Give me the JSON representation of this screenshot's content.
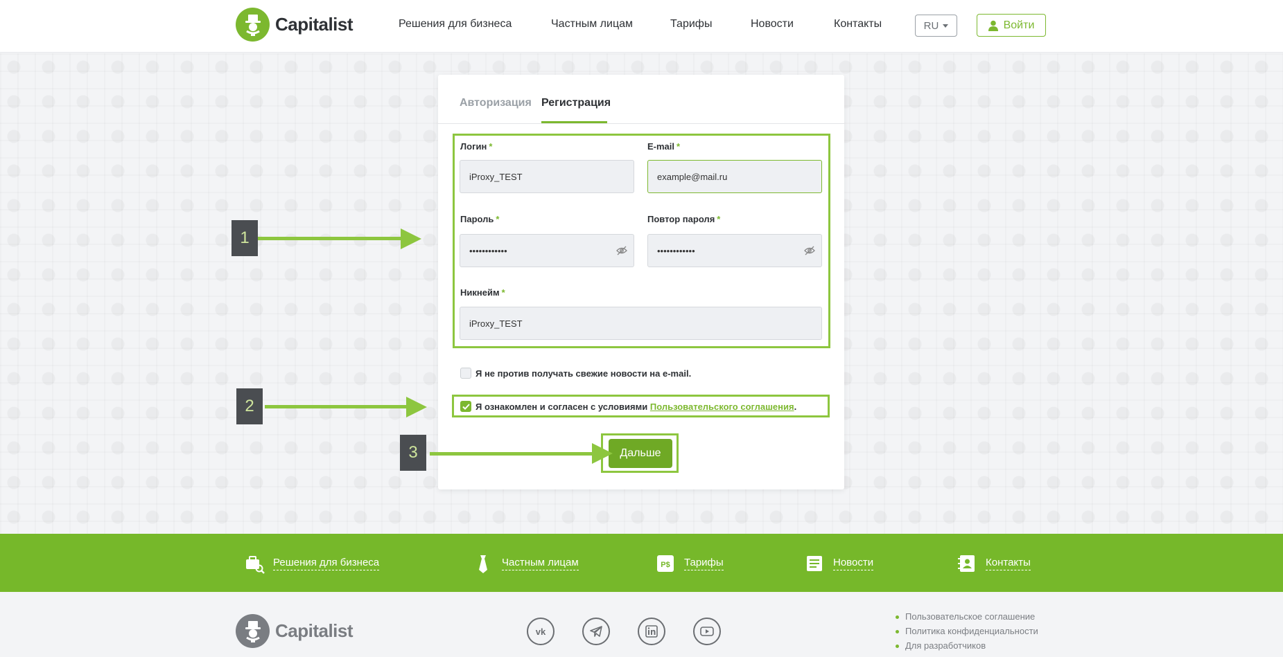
{
  "header": {
    "logo_text": "Capitalist",
    "nav": [
      "Решения для бизнеса",
      "Частным лицам",
      "Тарифы",
      "Новости",
      "Контакты"
    ],
    "lang": "RU",
    "login_label": "Войти"
  },
  "tabs": {
    "auth": "Авторизация",
    "register": "Регистрация"
  },
  "form": {
    "login_label": "Логин",
    "login_value": "iProxy_TEST",
    "email_label": "E-mail",
    "email_value": "example@mail.ru",
    "password_label": "Пароль",
    "password_value": "••••••••••••",
    "password_repeat_label": "Повтор пароля",
    "password_repeat_value": "••••••••••••",
    "nickname_label": "Никнейм",
    "nickname_value": "iProxy_TEST",
    "required_mark": "*",
    "newsletter_label": "Я не против получать свежие новости на e-mail.",
    "newsletter_checked": false,
    "terms_prefix": "Я ознакомлен и согласен с условиями",
    "terms_link": "Пользовательского соглашения",
    "terms_suffix": ".",
    "terms_checked": true,
    "next_label": "Дальше"
  },
  "markers": [
    "1",
    "2",
    "3"
  ],
  "band": {
    "items": [
      "Решения для бизнеса",
      "Частным лицам",
      "Тарифы",
      "Новости",
      "Контакты"
    ]
  },
  "footer": {
    "logo_text": "Capitalist",
    "social": [
      "vk-icon",
      "telegram-icon",
      "linkedin-icon",
      "youtube-icon"
    ],
    "links": [
      "Пользовательское соглашение",
      "Политика конфиденциальности",
      "Для разработчиков"
    ]
  },
  "colors": {
    "accent": "#7cb82f",
    "band": "#76b82a",
    "annotation": "#8dc63f",
    "marker_bg": "#4a4d51"
  }
}
